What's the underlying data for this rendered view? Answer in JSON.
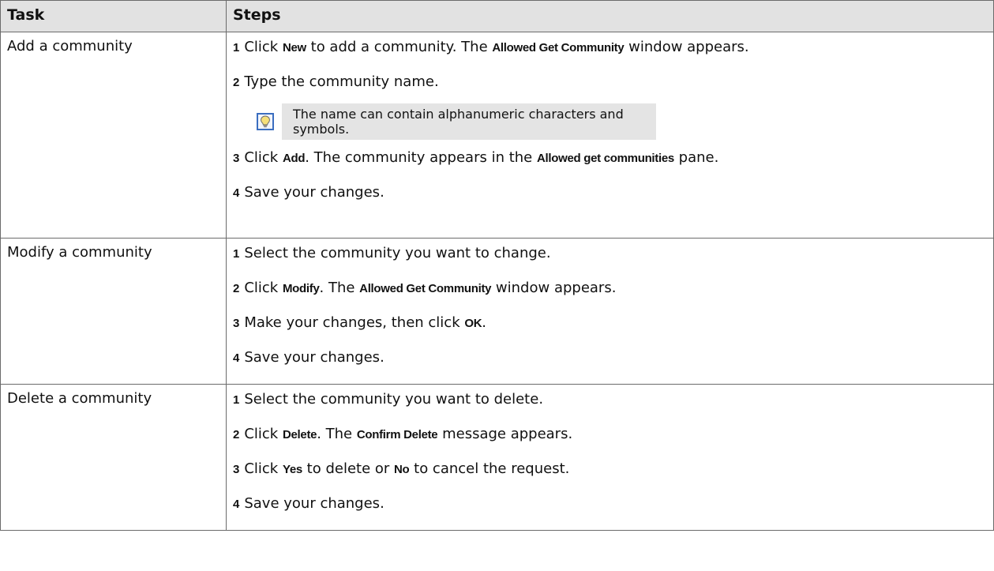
{
  "headers": {
    "task": "Task",
    "steps": "Steps"
  },
  "rows": [
    {
      "task": "Add a community",
      "steps": [
        {
          "num": "1",
          "parts": [
            {
              "text": "Click "
            },
            {
              "text": "New",
              "ui": true
            },
            {
              "text": " to add a community. The "
            },
            {
              "text": "Allowed Get Community",
              "ui": true
            },
            {
              "text": " window appears."
            }
          ]
        },
        {
          "num": "2",
          "parts": [
            {
              "text": "Type the community name."
            }
          ]
        },
        {
          "num": "3",
          "parts": [
            {
              "text": "Click "
            },
            {
              "text": "Add",
              "ui": true
            },
            {
              "text": ". The community appears in the "
            },
            {
              "text": "Allowed get communities",
              "ui": true
            },
            {
              "text": " pane."
            }
          ]
        },
        {
          "num": "4",
          "parts": [
            {
              "text": "Save your changes."
            }
          ]
        }
      ],
      "tip": {
        "after_step": 1,
        "icon": "lightbulb-icon",
        "text": "The name can contain alphanumeric characters and symbols."
      }
    },
    {
      "task": "Modify a community",
      "steps": [
        {
          "num": "1",
          "parts": [
            {
              "text": "Select the community you want to change."
            }
          ]
        },
        {
          "num": "2",
          "parts": [
            {
              "text": "Click "
            },
            {
              "text": "Modify",
              "ui": true
            },
            {
              "text": ". The "
            },
            {
              "text": "Allowed Get Community",
              "ui": true
            },
            {
              "text": " window appears."
            }
          ]
        },
        {
          "num": "3",
          "parts": [
            {
              "text": "Make your changes, then click "
            },
            {
              "text": "OK",
              "ui": true
            },
            {
              "text": "."
            }
          ]
        },
        {
          "num": "4",
          "parts": [
            {
              "text": "Save your changes."
            }
          ]
        }
      ]
    },
    {
      "task": "Delete a community",
      "steps": [
        {
          "num": "1",
          "parts": [
            {
              "text": "Select the community you want to delete."
            }
          ]
        },
        {
          "num": "2",
          "parts": [
            {
              "text": "Click "
            },
            {
              "text": "Delete",
              "ui": true
            },
            {
              "text": ". The "
            },
            {
              "text": "Confirm Delete",
              "ui": true
            },
            {
              "text": " message appears."
            }
          ]
        },
        {
          "num": "3",
          "parts": [
            {
              "text": "Click "
            },
            {
              "text": "Yes",
              "ui": true
            },
            {
              "text": " to delete or "
            },
            {
              "text": "No",
              "ui": true
            },
            {
              "text": " to cancel the request."
            }
          ]
        },
        {
          "num": "4",
          "parts": [
            {
              "text": "Save your changes."
            }
          ]
        }
      ]
    }
  ],
  "colors": {
    "header_bg": "#e2e2e2",
    "border": "#6b6b6b",
    "tip_bg": "#e4e4e4",
    "tip_icon_border": "#3b6ec0"
  }
}
